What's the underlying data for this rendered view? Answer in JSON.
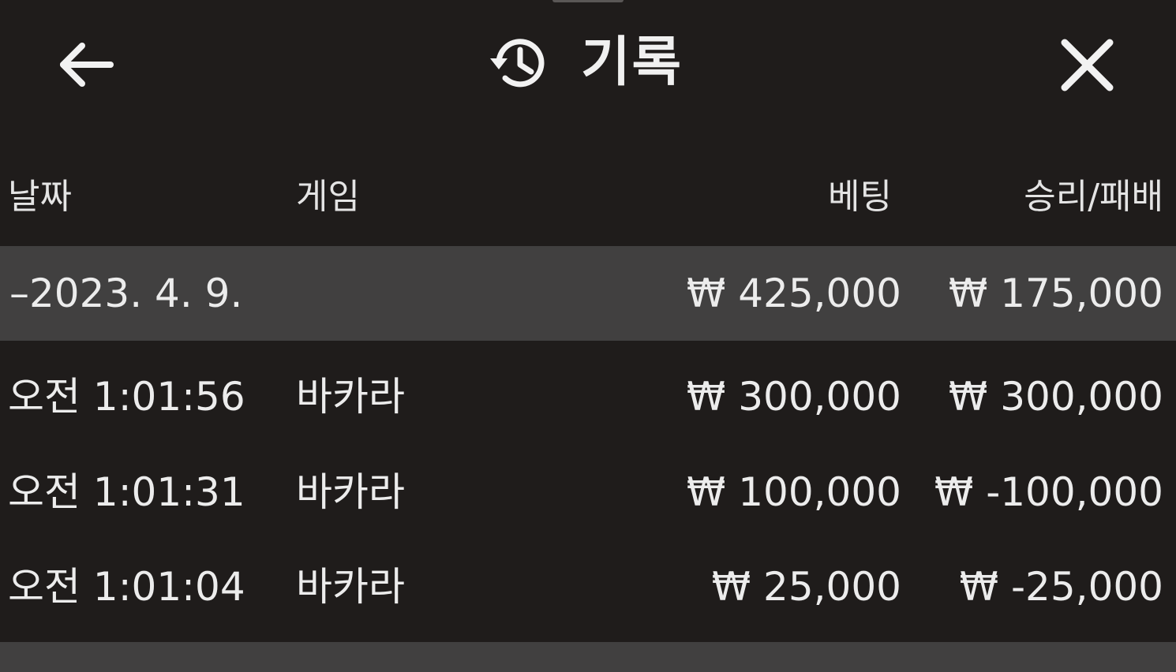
{
  "header": {
    "title": "기록",
    "back_icon": "arrow-left-icon",
    "history_icon": "history-icon",
    "close_icon": "close-icon"
  },
  "columns": {
    "date": "날짜",
    "game": "게임",
    "bet": "베팅",
    "result": "승리/패배"
  },
  "summary": {
    "date": "–2023. 4. 9.",
    "bet": "₩ 425,000",
    "result": "₩ 175,000"
  },
  "rows": [
    {
      "time": "오전 1:01:56",
      "game": "바카라",
      "bet": "₩ 300,000",
      "result": "₩ 300,000"
    },
    {
      "time": "오전 1:01:31",
      "game": "바카라",
      "bet": "₩ 100,000",
      "result": "₩ -100,000"
    },
    {
      "time": "오전 1:01:04",
      "game": "바카라",
      "bet": "₩ 25,000",
      "result": "₩ -25,000"
    }
  ],
  "colors": {
    "background": "#1f1c1b",
    "summary_row": "#414040",
    "text": "#e6e6e6"
  }
}
